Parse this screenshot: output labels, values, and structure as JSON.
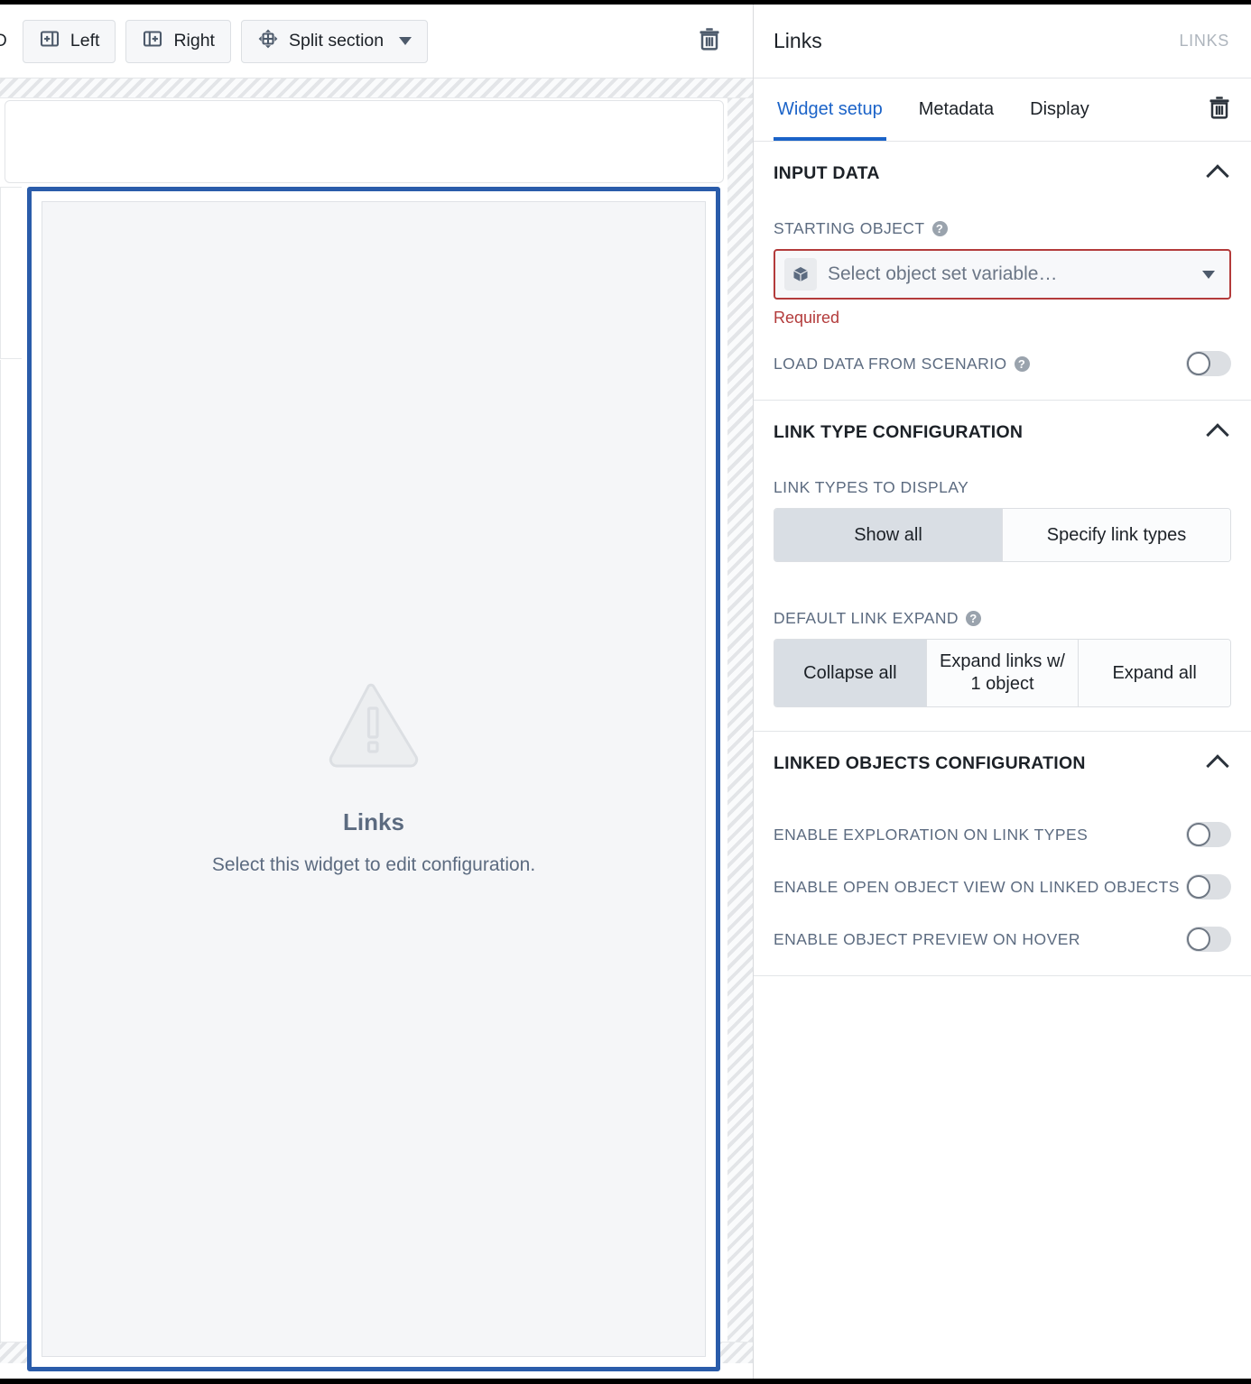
{
  "toolbar": {
    "cut_label": "D",
    "buttons": [
      {
        "label": "Left",
        "icon": "add-panel-left-icon"
      },
      {
        "label": "Right",
        "icon": "add-panel-right-icon"
      },
      {
        "label": "Split section",
        "icon": "split-section-icon"
      }
    ],
    "delete_icon": "trash-icon"
  },
  "canvas": {
    "widget": {
      "icon": "warning-triangle-icon",
      "title": "Links",
      "subtitle": "Select this widget to edit configuration."
    }
  },
  "panel": {
    "title": "Links",
    "badge": "LINKS",
    "delete_icon": "trash-icon",
    "tabs": [
      {
        "label": "Widget setup",
        "active": true
      },
      {
        "label": "Metadata",
        "active": false
      },
      {
        "label": "Display",
        "active": false
      }
    ],
    "sections": {
      "input_data": {
        "title": "INPUT DATA",
        "collapse_icon": "chevron-up-icon",
        "starting_object": {
          "label": "STARTING OBJECT",
          "help_icon": "help-icon",
          "value_icon": "cube-icon",
          "placeholder": "Select object set variable…",
          "dropdown_icon": "caret-down-icon",
          "error": "Required"
        },
        "load_from_scenario": {
          "label": "LOAD DATA FROM SCENARIO",
          "help_icon": "help-icon",
          "value": "off"
        }
      },
      "link_type_configuration": {
        "title": "LINK TYPE CONFIGURATION",
        "collapse_icon": "chevron-up-icon",
        "link_types_to_display": {
          "label": "LINK TYPES TO DISPLAY",
          "options": [
            "Show all",
            "Specify link types"
          ],
          "selected": "Show all"
        },
        "default_link_expand": {
          "label": "DEFAULT LINK EXPAND",
          "help_icon": "help-icon",
          "options": [
            "Collapse all",
            "Expand links w/ 1 object",
            "Expand all"
          ],
          "selected": "Collapse all"
        }
      },
      "linked_objects_configuration": {
        "title": "LINKED OBJECTS CONFIGURATION",
        "collapse_icon": "chevron-up-icon",
        "toggles": [
          {
            "label": "ENABLE EXPLORATION ON LINK TYPES",
            "value": "off"
          },
          {
            "label": "ENABLE OPEN OBJECT VIEW ON LINKED OBJECTS",
            "value": "off"
          },
          {
            "label": "ENABLE OBJECT PREVIEW ON HOVER",
            "value": "off"
          }
        ]
      }
    }
  },
  "colors": {
    "accent_blue": "#1b63c8",
    "selection_blue": "#2a5caa",
    "error_red": "#b33b3b",
    "text_dark": "#1c2127",
    "text_muted": "#5c6b80",
    "segment_selected": "#d9dee4"
  }
}
